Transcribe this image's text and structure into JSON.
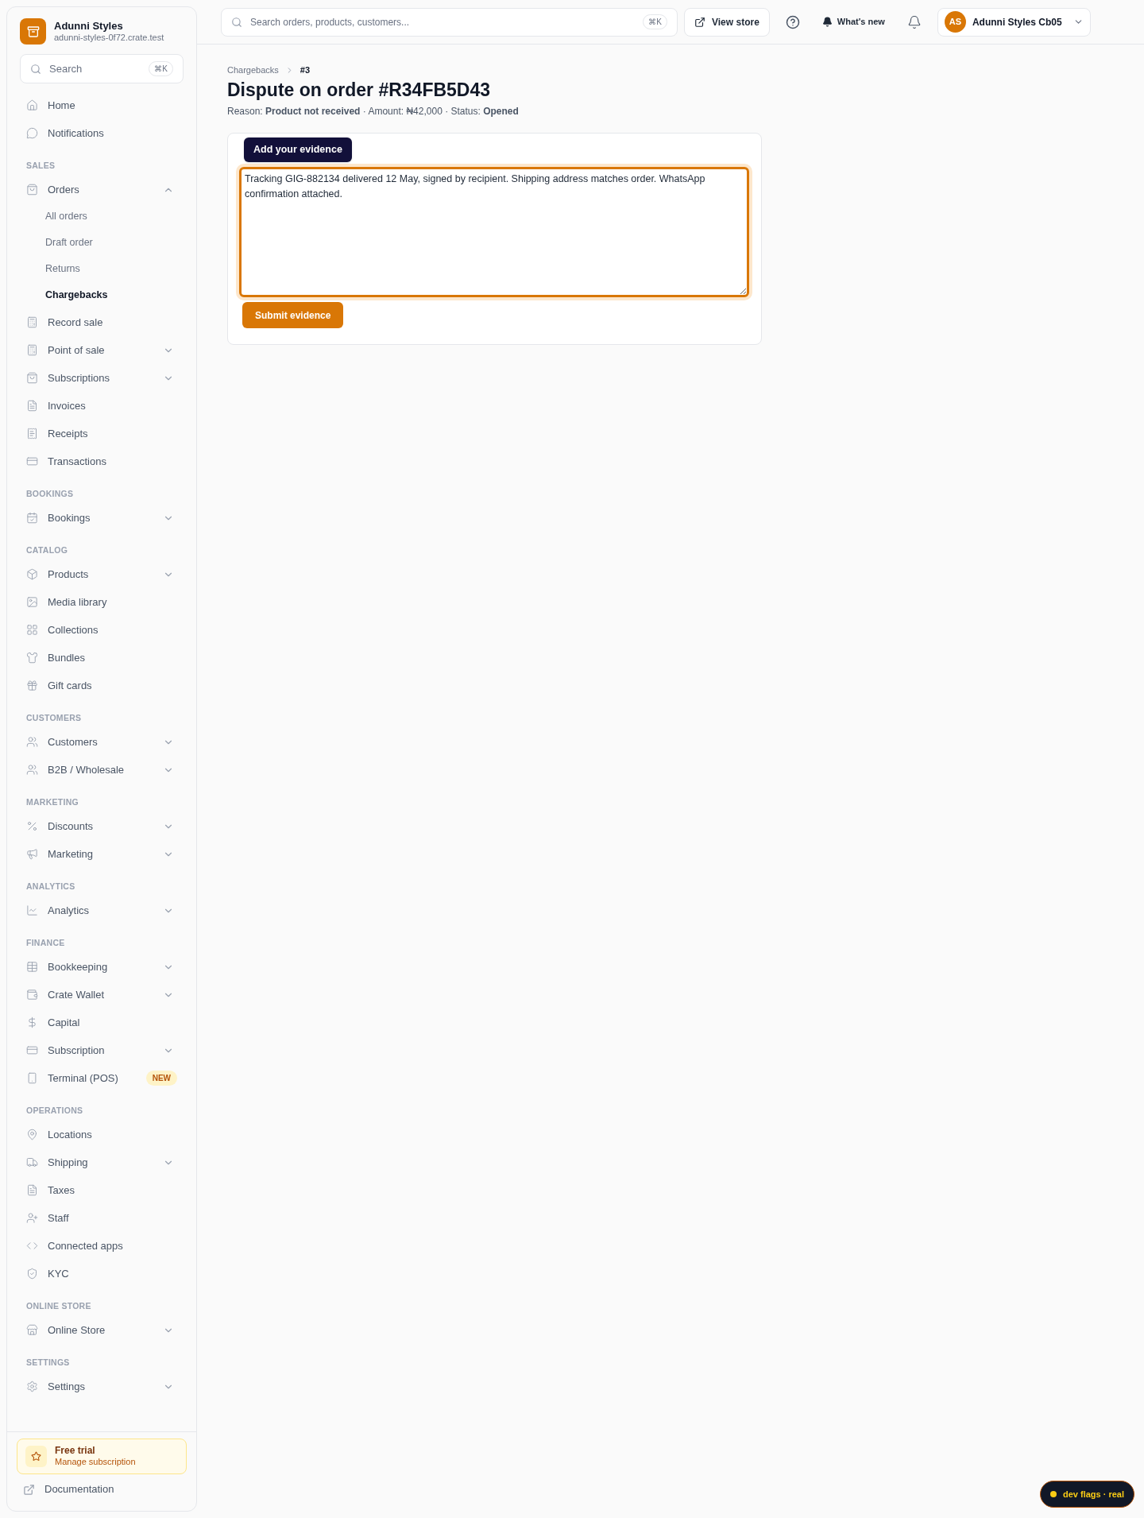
{
  "sidebar": {
    "store": {
      "name": "Adunni Styles",
      "domain": "adunni-styles-0f72.crate.test"
    },
    "search": {
      "placeholder": "Search",
      "shortcut": "⌘K"
    },
    "sections": [
      {
        "items": [
          {
            "label": "Home",
            "selected": false
          },
          {
            "label": "Notifications",
            "selected": false
          }
        ]
      },
      {
        "title": "SALES",
        "items": [
          {
            "label": "Orders",
            "selected": false,
            "expanded": true,
            "children": [
              {
                "label": "All orders",
                "selected": false
              },
              {
                "label": "Draft order",
                "selected": false
              },
              {
                "label": "Returns",
                "selected": false
              },
              {
                "label": "Chargebacks",
                "selected": true
              }
            ]
          },
          {
            "label": "Record sale",
            "selected": false
          },
          {
            "label": "Point of sale",
            "selected": false,
            "expanded": false
          },
          {
            "label": "Subscriptions",
            "selected": false,
            "expanded": false
          },
          {
            "label": "Invoices",
            "selected": false
          },
          {
            "label": "Receipts",
            "selected": false
          },
          {
            "label": "Transactions",
            "selected": false
          }
        ]
      },
      {
        "title": "BOOKINGS",
        "items": [
          {
            "label": "Bookings",
            "selected": false,
            "expanded": false
          }
        ]
      },
      {
        "title": "CATALOG",
        "items": [
          {
            "label": "Products",
            "selected": false,
            "expanded": false
          },
          {
            "label": "Media library",
            "selected": false
          },
          {
            "label": "Collections",
            "selected": false
          },
          {
            "label": "Bundles",
            "selected": false
          },
          {
            "label": "Gift cards",
            "selected": false
          }
        ]
      },
      {
        "title": "CUSTOMERS",
        "items": [
          {
            "label": "Customers",
            "selected": false,
            "expanded": false
          },
          {
            "label": "B2B / Wholesale",
            "selected": false,
            "expanded": false
          }
        ]
      },
      {
        "title": "MARKETING",
        "items": [
          {
            "label": "Discounts",
            "selected": false,
            "expanded": false
          },
          {
            "label": "Marketing",
            "selected": false,
            "expanded": false
          }
        ]
      },
      {
        "title": "ANALYTICS",
        "items": [
          {
            "label": "Analytics",
            "selected": false,
            "expanded": false
          }
        ]
      },
      {
        "title": "FINANCE",
        "items": [
          {
            "label": "Bookkeeping",
            "selected": false,
            "expanded": false
          },
          {
            "label": "Crate Wallet",
            "selected": false,
            "expanded": false
          },
          {
            "label": "Capital",
            "selected": false
          },
          {
            "label": "Subscription",
            "selected": false,
            "expanded": false
          },
          {
            "label": "Terminal (POS)",
            "selected": false,
            "badge": "NEW"
          }
        ]
      },
      {
        "title": "OPERATIONS",
        "items": [
          {
            "label": "Locations",
            "selected": false
          },
          {
            "label": "Shipping",
            "selected": false,
            "expanded": false
          },
          {
            "label": "Taxes",
            "selected": false
          },
          {
            "label": "Staff",
            "selected": false
          },
          {
            "label": "Connected apps",
            "selected": false
          },
          {
            "label": "KYC",
            "selected": false
          }
        ]
      },
      {
        "title": "ONLINE STORE",
        "items": [
          {
            "label": "Online Store",
            "selected": false,
            "expanded": false
          }
        ]
      },
      {
        "title": "SETTINGS",
        "items": [
          {
            "label": "Settings",
            "selected": false,
            "expanded": false
          }
        ]
      }
    ],
    "trial": {
      "title": "Free trial",
      "subtitle": "Manage subscription"
    },
    "documentation": "Documentation"
  },
  "topbar": {
    "search": {
      "placeholder": "Search orders, products, customers...",
      "shortcut": "⌘K"
    },
    "view_store": "View store",
    "whats_new": "What's new",
    "account": {
      "initials": "AS",
      "name": "Adunni Styles Cb05"
    }
  },
  "breadcrumb": [
    "Chargebacks",
    "#3"
  ],
  "title": "Dispute on order #R34FB5D43",
  "meta": "Reason: **Product not received** · Amount: ₦42,000 · Status: **Opened**",
  "evidence": {
    "tooltip": "Add your evidence",
    "value": "Tracking GIG-882134 delivered 12 May, signed by recipient. Shipping address matches order. WhatsApp confirmation attached.",
    "submit": "Submit evidence"
  },
  "dev_flags": {
    "label": "dev flags · real",
    "color": "#facc15"
  }
}
